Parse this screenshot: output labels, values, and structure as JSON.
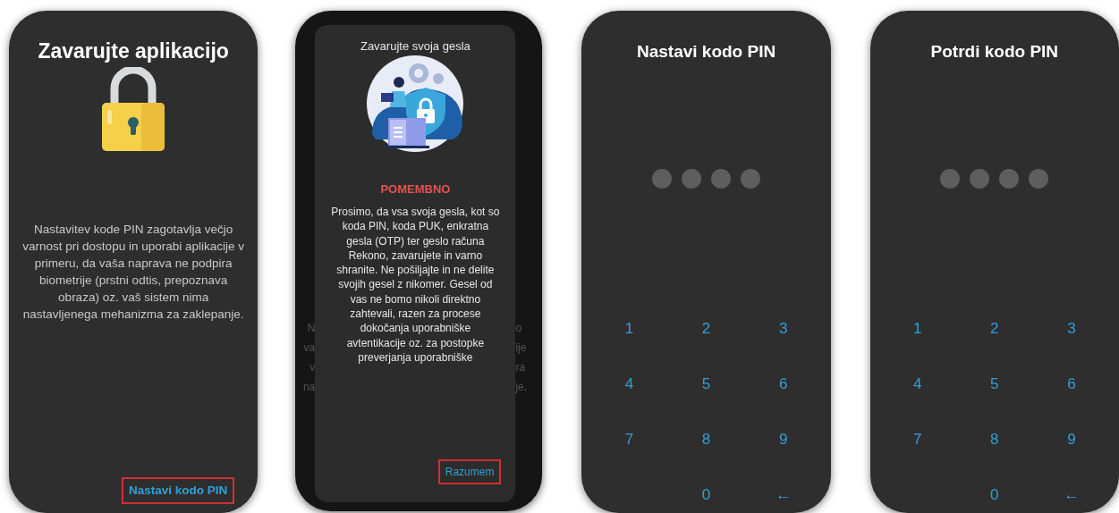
{
  "screens": [
    {
      "kind": "intro",
      "title": "Zavarujte aplikacijo",
      "body": "Nastavitev kode PIN zagotavlja večjo varnost pri dostopu in uporabi aplikacije v primeru, da vaša naprava ne podpira biometrije (prstni odtis, prepoznava obraza) oz. vaš sistem nima nastavljenega mehanizma za zaklepanje.",
      "action": {
        "label": "Nastavi kodo PIN",
        "highlighted": true
      }
    },
    {
      "kind": "dialog",
      "title": "Zavarujte svoja gesla",
      "heading": "POMEMBNO",
      "body": "Prosimo, da vsa svoja gesla, kot so koda PIN, koda PUK, enkratna gesla (OTP) ter geslo računa Rekono, zavarujete in varno shranite. Ne pošiljajte in ne delite svojih gesel z nikomer. Gesel od vas ne bomo nikoli direktno zahtevali, razen za procese dokočanja uporabniške avtentikacije oz. za postopke preverjanja uporabniške",
      "action": {
        "label": "Razumem",
        "highlighted": true
      },
      "background_left": [
        "N",
        "va",
        "v",
        "na"
      ],
      "background_right": [
        "o",
        "ije",
        "ra",
        "je."
      ]
    },
    {
      "kind": "pin",
      "title": "Nastavi kodo PIN",
      "dots": [
        {
          "filled": false
        },
        {
          "filled": false
        },
        {
          "filled": false
        },
        {
          "filled": false
        }
      ],
      "keys": [
        {
          "label": "1"
        },
        {
          "label": "2"
        },
        {
          "label": "3"
        },
        {
          "label": "4"
        },
        {
          "label": "5"
        },
        {
          "label": "6"
        },
        {
          "label": "7"
        },
        {
          "label": "8"
        },
        {
          "label": "9"
        },
        {
          "label": "0"
        },
        {
          "label": "←"
        }
      ]
    },
    {
      "kind": "pin",
      "title": "Potrdi kodo PIN",
      "dots": [
        {
          "filled": false
        },
        {
          "filled": false
        },
        {
          "filled": false
        },
        {
          "filled": false
        }
      ],
      "keys": [
        {
          "label": "1"
        },
        {
          "label": "2"
        },
        {
          "label": "3"
        },
        {
          "label": "4"
        },
        {
          "label": "5"
        },
        {
          "label": "6"
        },
        {
          "label": "7"
        },
        {
          "label": "8"
        },
        {
          "label": "9"
        },
        {
          "label": "0"
        },
        {
          "label": "←"
        }
      ]
    }
  ]
}
